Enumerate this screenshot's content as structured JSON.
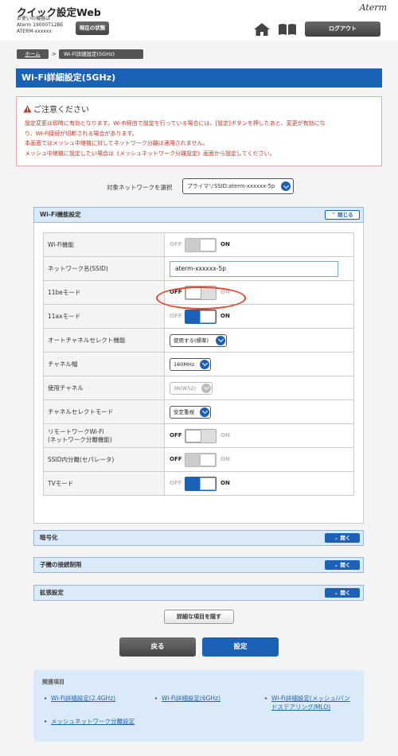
{
  "header": {
    "app_title": "クイック設定Web",
    "device_caption": "お使いの機器は",
    "device_model": "Aterm 19000T12BE",
    "device_name": "ATERM-xxxxxx",
    "status_button": "現在の状態",
    "brand": "Aterm",
    "logout_button": "ログアウト"
  },
  "breadcrumb": {
    "home": "ホーム",
    "separator": ">",
    "current": "Wi-Fi詳細設定(5GHz)"
  },
  "page_title": "Wi-Fi詳細設定(5GHz)",
  "caution": {
    "title": "ご注意ください",
    "lines": [
      "設定変更は即時に有効となります。Wi-Fi経由で設定を行っている場合には、[設定]ボタンを押したあと、変更が有効にな",
      "り、Wi-Fi接続が切断される場合があります。",
      "本画面ではメッシュ中継機に対してネットワーク分離は適用されません。",
      "メッシュ中継機に設定したい場合は《メッシュネットワーク分離設定》画面から設定してください。"
    ]
  },
  "network_select": {
    "label": "対象ネットワークを選択",
    "value": "プライマリSSID:aterm-xxxxxx-5p"
  },
  "wifi_section": {
    "title": "Wi-Fi機能設定",
    "toggle_button": "閉じる",
    "off_text": "OFF",
    "on_text": "ON",
    "rows": {
      "wifi": {
        "label": "Wi-Fi機能"
      },
      "ssid": {
        "label": "ネットワーク名(SSID)",
        "value": "aterm-xxxxxx-5p"
      },
      "mode_11be": {
        "label": "11beモード"
      },
      "mode_11ax": {
        "label": "11axモード"
      },
      "auto_channel": {
        "label": "オートチャネルセレクト機能",
        "value": "使用する(標準)"
      },
      "channel_width": {
        "label": "チャネル幅",
        "value": "160MHz"
      },
      "channel": {
        "label": "使用チャネル",
        "value": "36(W52)"
      },
      "channel_select_mode": {
        "label": "チャネルセレクトモード",
        "value": "安定重視"
      },
      "remote_work": {
        "label_line1": "リモートワークWi-Fi",
        "label_line2": "(ネットワーク分離機能)"
      },
      "ssid_separator": {
        "label": "SSID内分離(セパレータ)"
      },
      "tv_mode": {
        "label": "TVモード"
      }
    }
  },
  "sections": {
    "encryption": {
      "title": "暗号化",
      "button": "開く"
    },
    "client_limit": {
      "title": "子機の接続制限",
      "button": "開く"
    },
    "extended": {
      "title": "拡張設定",
      "button": "開く"
    }
  },
  "actions": {
    "hide_details": "詳細な項目を隠す",
    "back": "戻る",
    "submit": "設定"
  },
  "related": {
    "title": "関連項目",
    "links": {
      "wifi_24": "Wi-Fi詳細設定(2.4GHz)",
      "wifi_6": "Wi-Fi詳細設定(6GHz)",
      "mesh_line1": "Wi-Fi詳細設定(メッシュ/バン",
      "mesh_line2": "ドステアリング/MLO)",
      "mesh_separation": "メッシュネットワーク分離設定"
    }
  },
  "colors": {
    "primary_blue": "#1b62b6",
    "caution_red": "#c0392b",
    "highlight_oval": "#e8452c",
    "section_head_bg": "#dbeaf8"
  }
}
